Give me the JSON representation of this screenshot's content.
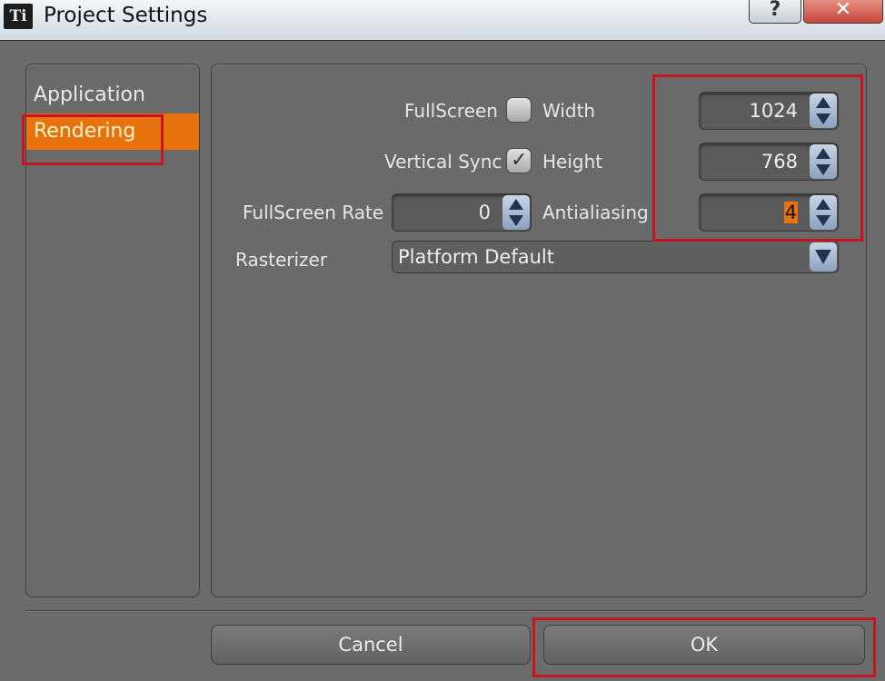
{
  "window": {
    "icon_text": "Ti",
    "title": "Project Settings",
    "help_label": "?",
    "close_label": "✕"
  },
  "sidebar": {
    "items": [
      {
        "label": "Application",
        "active": false
      },
      {
        "label": "Rendering",
        "active": true
      }
    ]
  },
  "rendering": {
    "fullscreen": {
      "label": "FullScreen",
      "checked": false
    },
    "vertical_sync": {
      "label": "Vertical Sync",
      "checked": true,
      "check_glyph": "✓"
    },
    "fullscreen_rate": {
      "label": "FullScreen Rate",
      "value": "0"
    },
    "width": {
      "label": "Width",
      "value": "1024"
    },
    "height": {
      "label": "Height",
      "value": "768"
    },
    "antialiasing": {
      "label": "Antialiasing",
      "value": "4"
    },
    "rasterizer": {
      "label": "Rasterizer",
      "value": "Platform Default"
    }
  },
  "buttons": {
    "cancel": "Cancel",
    "ok": "OK"
  },
  "colors": {
    "accent": "#e8730e",
    "highlight_box": "#c8141e",
    "panel": "#6a6a6a"
  }
}
